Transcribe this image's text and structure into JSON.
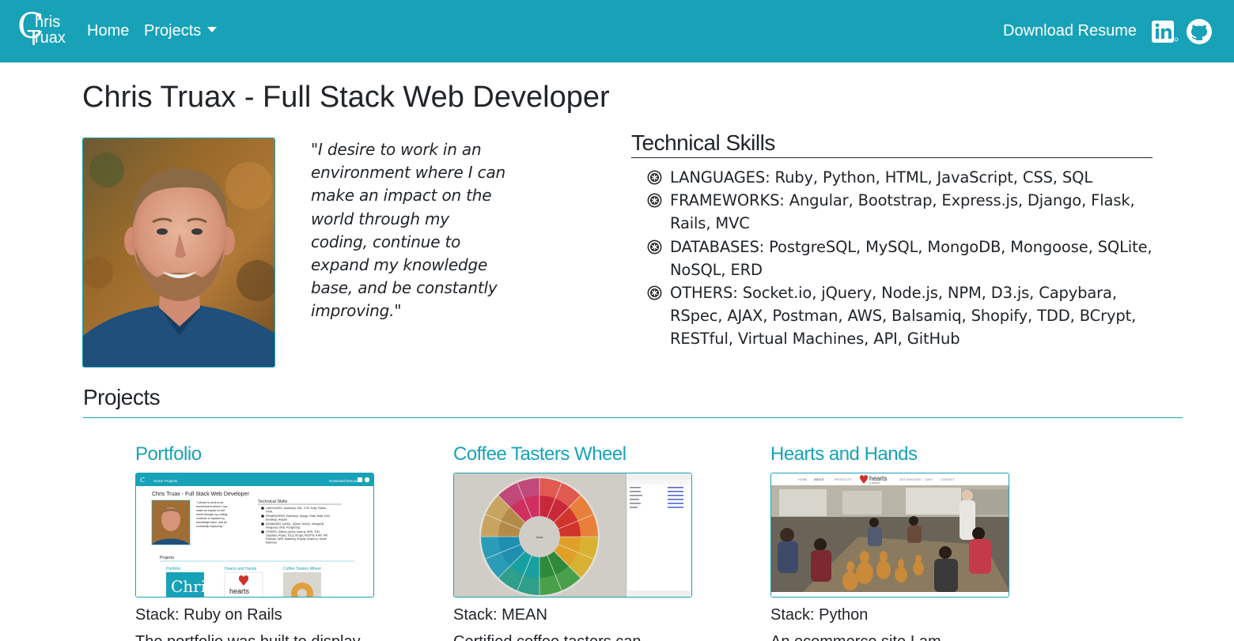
{
  "navbar": {
    "brand": {
      "first": "C",
      "first_rest": "hris",
      "second": "T",
      "second_rest": "ruax"
    },
    "home_label": "Home",
    "projects_label": "Projects",
    "resume_label": "Download Resume",
    "linkedin_icon": "linkedin-icon",
    "github_icon": "github-icon",
    "color": "#17a2b8"
  },
  "header": {
    "title": "Chris Truax - Full Stack Web Developer",
    "quote": "\"I desire to work in an environment where I can make an impact on the world through my coding, continue to expand my knowledge base, and be constantly improving.\""
  },
  "skills": {
    "title": "Technical Skills",
    "items": [
      {
        "label": "LANGUAGES: Ruby, Python, HTML, JavaScript, CSS, SQL"
      },
      {
        "label": "FRAMEWORKS: Angular, Bootstrap, Express.js, Django, Flask, Rails, MVC"
      },
      {
        "label": "DATABASES: PostgreSQL, MySQL, MongoDB, Mongoose, SQLite, NoSQL, ERD"
      },
      {
        "label": "OTHERS: Socket.io, jQuery, Node.js, NPM, D3.js, Capybara, RSpec, AJAX, Postman, AWS, Balsamiq, Shopify, TDD, BCrypt, RESTful, Virtual Machines, API, GitHub"
      }
    ]
  },
  "projects": {
    "title": "Projects",
    "items": [
      {
        "title": "Portfolio",
        "stack": "Stack: Ruby on Rails",
        "desc": "The portfolio was built to display"
      },
      {
        "title": "Coffee Tasters Wheel",
        "stack": "Stack: MEAN",
        "desc": "Certified coffee tasters can"
      },
      {
        "title": "Hearts and Hands",
        "stack": "Stack: Python",
        "desc": "An ecommerce site I am"
      }
    ]
  },
  "thumbnails": {
    "portfolio": {
      "nav_home": "Home",
      "nav_projects": "Projects",
      "nav_resume": "Download Resume",
      "title": "Chris Truax - Full Stack Web Developer",
      "skills_title": "Technical Skills",
      "projects_title": "Projects",
      "p1": "Portfolio",
      "p2": "Hearts and Hands",
      "p3": "Coffee Tasters Wheel",
      "hearts_word": "hearts"
    },
    "coffee": {
      "center_label": "back"
    },
    "hearts": {
      "nav_items": [
        "HOME",
        "ABOUT",
        "PRODUCTS",
        "GET INVOLVED",
        "CART",
        "CONTACT"
      ],
      "logo_word": "hearts",
      "logo_sub": "& HANDS"
    }
  }
}
